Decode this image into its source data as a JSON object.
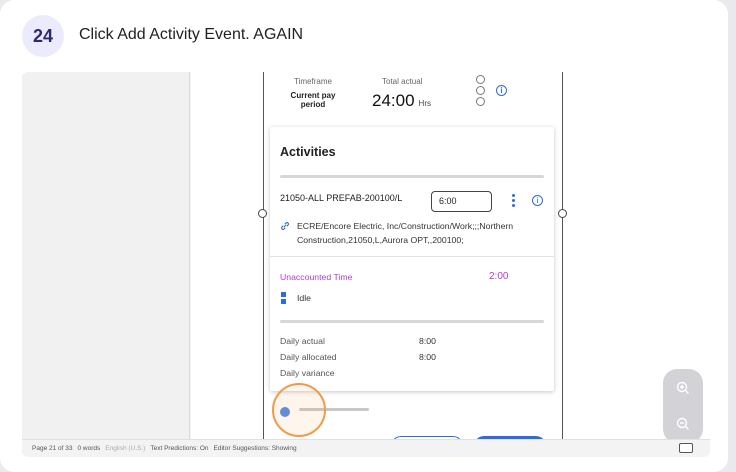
{
  "step": {
    "number": "24",
    "title": "Click Add Activity Event. AGAIN"
  },
  "summary": {
    "timeframe_label": "Timeframe",
    "timeframe_value": "Current pay period",
    "total_label": "Total actual",
    "total_value": "24:00",
    "total_unit": "Hrs",
    "info_glyph": "i"
  },
  "activities": {
    "title": "Activities",
    "item": {
      "code": "21050-ALL PREFAB-200100/L",
      "hours": "6:00",
      "path": "ECRE/Encore Electric, Inc/Construction/Work;;;Northern Construction,21050,L,Aurora OPT,,200100;",
      "info_glyph": "i"
    },
    "unaccounted_label": "Unaccounted Time",
    "unaccounted_value": "2:00",
    "idle_label": "Idle",
    "daily": [
      {
        "label": "Daily actual",
        "value": "8:00"
      },
      {
        "label": "Daily allocated",
        "value": "8:00"
      },
      {
        "label": "Daily variance",
        "value": ""
      }
    ]
  },
  "status_bar": {
    "page": "Page 21 of 33",
    "words": "0 words",
    "language": "English (U.S.)",
    "text_predictions": "Text Predictions: On",
    "editor": "Editor Suggestions: Showing"
  },
  "icons": {
    "link": "link-icon",
    "zoom_in": "zoom-in-icon",
    "zoom_out": "zoom-out-icon",
    "more": "more-vertical-icon",
    "info": "info-icon",
    "idle": "idle-icon"
  },
  "colors": {
    "accent": "#2c6be0",
    "highlight": "#f29a4a",
    "unaccounted": "#b040d0",
    "badge_bg": "#ecebfd"
  }
}
